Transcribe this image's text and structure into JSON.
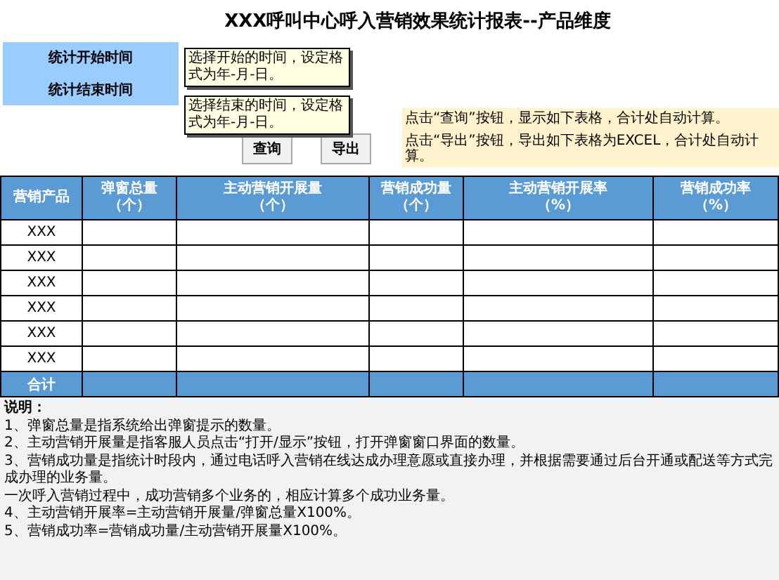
{
  "title": "XXX呼叫中心呼入营销效果统计报表--产品维度",
  "filters": [
    {
      "label": "统计开始时间",
      "comment": "选择开始的时间，设定格式为年-月-日。"
    },
    {
      "label": "统计结束时间",
      "comment": "选择结束的时间，设定格式为年-月-日。"
    }
  ],
  "buttons": [
    "查询",
    "导出"
  ],
  "hints": [
    "点击“查询”按钮，显示如下表格，合计处自动计算。",
    "点击“导出”按钮，导出如下表格为EXCEL，合计处自动计算。"
  ],
  "table": {
    "columns": [
      {
        "label": "营销产品"
      },
      {
        "label": "弹窗总量",
        "unit": "（个）"
      },
      {
        "label": "主动营销开展量",
        "unit": "（个）"
      },
      {
        "label": "营销成功量",
        "unit": "（个）"
      },
      {
        "label": "主动营销开展率",
        "unit": "（%）"
      },
      {
        "label": "营销成功率",
        "unit": "（%）"
      }
    ],
    "rows": [
      {
        "product": "XXX"
      },
      {
        "product": "XXX"
      },
      {
        "product": "XXX"
      },
      {
        "product": "XXX"
      },
      {
        "product": "XXX"
      },
      {
        "product": "XXX"
      }
    ],
    "total_label": "合计"
  },
  "notes": {
    "title": "说明：",
    "lines": [
      "1、弹窗总量是指系统给出弹窗提示的数量。",
      "2、主动营销开展量是指客服人员点击“打开/显示”按钮，打开弹窗窗口界面的数量。",
      "3、营销成功量是指统计时段内，通过电话呼入营销在线达成办理意愿或直接办理，并根据需要通过后台开通或配送等方式完成办理的业务量。",
      "一次呼入营销过程中，成功营销多个业务的，相应计算多个成功业务量。",
      "4、主动营销开展率=主动营销开展量/弹窗总量X100%。",
      "5、营销成功率=营销成功量/主动营销开展量X100%。"
    ]
  }
}
